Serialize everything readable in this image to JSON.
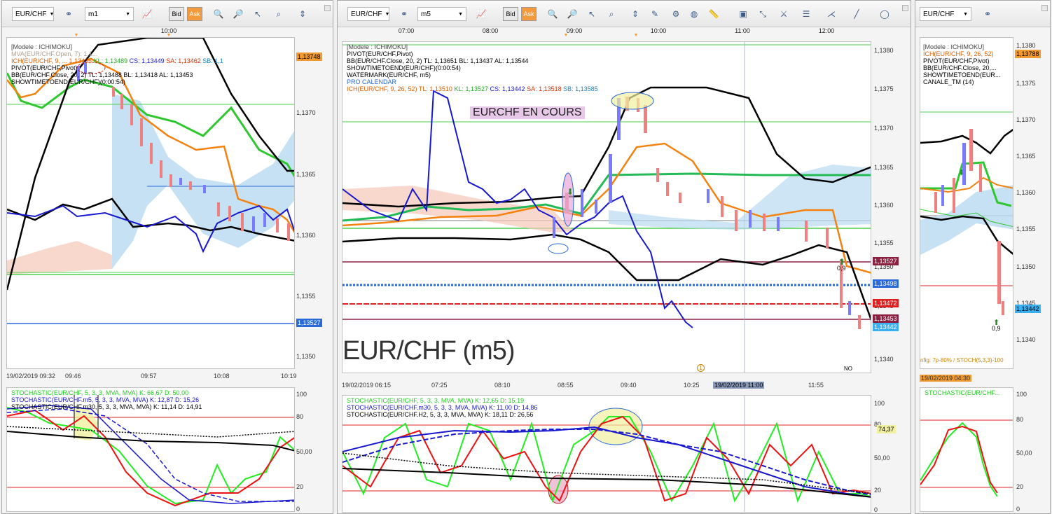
{
  "colors": {
    "green": "#2ec82e",
    "orange": "#f5820f",
    "black": "#000000",
    "blue": "#1818d0",
    "cloud": "#b8daf0",
    "candle_up": "#7a7aff",
    "candle_dn": "#f08080",
    "stoch_green": "#22ee22",
    "stoch_red": "#ee1111",
    "pricetag_orange": "#f29a2f",
    "pricetag_maroon": "#8b2040",
    "pricetag_blue": "#2a6ad8",
    "pricetag_cyan": "#3ab0f0"
  },
  "pane1": {
    "symbol": "EUR/CHF",
    "timeframe": "m1",
    "bid": "Bid",
    "ask": "Ask",
    "time_labels": [
      "10:00"
    ],
    "indicators": [
      "[Modele : ICHIMOKU]",
      "MVA(EUR/CHF.Open, 7): 1,1...",
      "ICH(EUR/CHF, 9, ...",
      "PIVOT(EUR/CHF,Pivot)",
      "BB(EUR/CHF.Close, 20, 2)  TL: 1,13488  BL: 1,13418  AL: 1,13453",
      "SHOWTIMETOEND(EUR/CHF)(0:00:54)"
    ],
    "ich_values": {
      "tl": "1,13435",
      "kl": "KL: 1,13489",
      "cs": "CS: 1,13449",
      "sa": "SA: 1,13462",
      "sb": "SB: 1,1"
    },
    "yaxis": [
      "1,1370",
      "1,1365",
      "1,1360",
      "1,1355",
      "1,1350"
    ],
    "price_tags": {
      "orange": "1,13748",
      "blue": "1,13527"
    },
    "dates": [
      "19/02/2019 09:32",
      "09:46",
      "09:57",
      "10:08",
      "10:19"
    ],
    "stoch": [
      "STOCHASTIC(EUR/CHF, 5, 3, 3, MVA, MVA)  K: 66,67  D: 50,00",
      "STOCHASTIC(EUR/CHF.m5, 5, 3, 3, MVA, MVA)  K: 12,87  D: 15,26",
      "STOCHASTIC(EUR/CHF.m30, 5, 3, 3, MVA, MVA)  K: 11,14  D: 14,91"
    ],
    "stoch_axis": [
      "100",
      "80",
      "50,00",
      "20",
      "0"
    ]
  },
  "pane2": {
    "symbol": "EUR/CHF",
    "timeframe": "m5",
    "bid": "Bid",
    "ask": "Ask",
    "time_labels": [
      "07:00",
      "08:00",
      "09:00",
      "10:00",
      "11:00",
      "12:00"
    ],
    "indicators": [
      "[Modele : ICHIMOKU]",
      "PIVOT(EUR/CHF,Pivot)",
      "BB(EUR/CHF.Close, 20, 2)  TL: 1,13651  BL: 1,13437  AL: 1,13544",
      "SHOWTIMETOEND(EUR/CHF)(0:00:54)",
      "WATERMARK(EUR/CHF, m5)",
      "PRO CALENDAR"
    ],
    "ich_line": {
      "name": "ICH(EUR/CHF, 9, 26, 52)",
      "tl": "TL: 1,13510",
      "kl": "KL: 1,13527",
      "cs": "CS: 1,13442",
      "sa": "SA: 1,13518",
      "sb": "SB: 1,13585"
    },
    "watermark_text": "EURCHF EN COURS",
    "big_symbol": "EUR/CHF (m5)",
    "no_news": "NO NEWS",
    "circle_marker": "1",
    "yaxis": [
      "1,1380",
      "1,1375",
      "1,1370",
      "1,1365",
      "1,1360",
      "1,1355",
      "1,1350",
      "1,1345",
      "1,1340"
    ],
    "price_tags": {
      "maroon1": "1,13527",
      "blue": "1,13498",
      "red": "1,13472",
      "maroon2": "1,13453",
      "cyan": "1,13442"
    },
    "arrow_label": "0,9",
    "dates": [
      "19/02/2019 06:15",
      "07:25",
      "08:10",
      "08:55",
      "09:40",
      "10:25",
      "19/02/2019 11:00",
      "11:55"
    ],
    "stoch": [
      "STOCHASTIC(EUR/CHF, 5, 3, 3, MVA, MVA)  K: 12,65  D: 15,19",
      "STOCHASTIC(EUR/CHF.m30, 5, 3, 3, MVA, MVA)  K: 11,00  D: 14,86",
      "STOCHASTIC(EUR/CHF.H2, 5, 3, 3, MVA, MVA)  K: 18,11  D: 26,56"
    ],
    "stoch_axis": [
      "100",
      "80",
      "50,00",
      "20",
      "0"
    ],
    "stoch_tag": "74,37"
  },
  "pane3": {
    "symbol": "EUR/CHF",
    "indicators": [
      "[Modele : ICHIMOKU]",
      "ICH(EUR/CHF, 9, 26, 52)",
      "PIVOT(EUR/CHF,Pivot)",
      "BB(EUR/CHF.Close, 20,...",
      "SHOWTIMETOEND(EUR...",
      "CANALE_TM (14)"
    ],
    "yaxis": [
      "1,1380",
      "1,1375",
      "1,1370",
      "1,1365",
      "1,1360",
      "1,1355",
      "1,1350",
      "1,1345",
      "1,1340"
    ],
    "price_tags": {
      "orange": "1,13788",
      "cyan": "1,13442"
    },
    "arrow_label": "0,9",
    "footer_text": "nfig: 7p-80% / STOCH(5,3,3)-100",
    "date": "19/02/2019 04:30",
    "stoch": [
      "STOCHASTIC(EUR/CHF..."
    ],
    "stoch_axis": [
      "100",
      "80",
      "50,00",
      "20",
      "0"
    ]
  }
}
